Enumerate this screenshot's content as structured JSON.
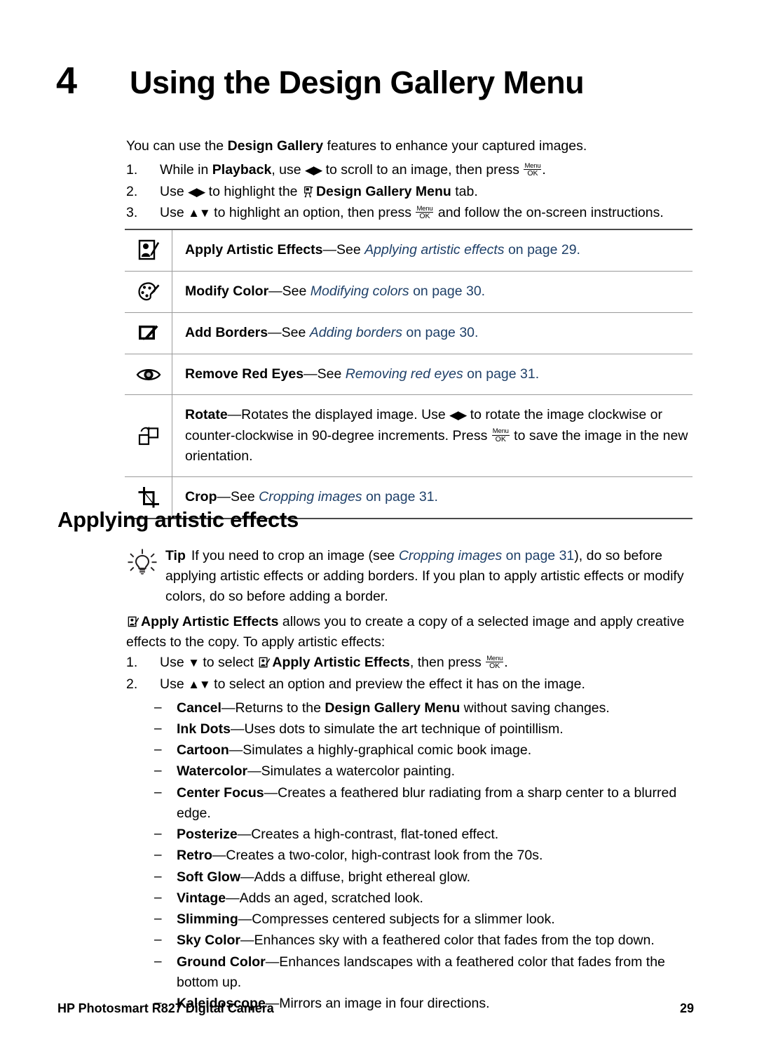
{
  "chapter": {
    "number": "4",
    "title": "Using the Design Gallery Menu"
  },
  "intro": {
    "pre": "You can use the ",
    "bold": "Design Gallery",
    "post": " features to enhance your captured images."
  },
  "steps": [
    {
      "num": "1.",
      "a": "While in ",
      "bold1": "Playback",
      "b": ", use ",
      "arrows": "◀▶",
      "c": " to scroll to an image, then press ",
      "key_top": "Menu",
      "key_bottom": "OK",
      "d": "."
    },
    {
      "num": "2.",
      "a": "Use ",
      "arrows": "◀▶",
      "b": " to highlight the ",
      "icon": "design-gallery-tab-icon",
      "bold1": "Design Gallery Menu",
      "c": " tab."
    },
    {
      "num": "3.",
      "a": "Use ",
      "arrows": "▲▼",
      "b": " to highlight an option, then press ",
      "key_top": "Menu",
      "key_bottom": "OK",
      "c": " and follow the on-screen instructions."
    }
  ],
  "menu_table": {
    "rows": [
      {
        "icon": "artistic-effects-icon",
        "title": "Apply Artistic Effects",
        "dash": "—",
        "see": "See ",
        "link": "Applying artistic effects",
        "tail": " on page 29."
      },
      {
        "icon": "color-palette-icon",
        "title": "Modify Color",
        "dash": "—",
        "see": "See ",
        "link": "Modifying colors",
        "tail": " on page 30."
      },
      {
        "icon": "add-borders-icon",
        "title": "Add Borders",
        "dash": "—",
        "see": "See ",
        "link": "Adding borders",
        "tail": " on page 30."
      },
      {
        "icon": "eye-icon",
        "title": "Remove Red Eyes",
        "dash": "—",
        "see": "See ",
        "link": "Removing red eyes",
        "tail": " on page 31."
      },
      {
        "icon": "rotate-icon",
        "title": "Rotate",
        "dash": "—",
        "body_a": "Rotates the displayed image. Use ",
        "arrows": "◀▶",
        "body_b": " to rotate the image clockwise or counter-clockwise in 90-degree increments. Press ",
        "key_top": "Menu",
        "key_bottom": "OK",
        "body_c": " to save the image in the new orientation."
      },
      {
        "icon": "crop-icon",
        "title": "Crop",
        "dash": "—",
        "see": "See ",
        "link": "Cropping images",
        "tail": " on page 31."
      }
    ]
  },
  "section": {
    "heading": "Applying artistic effects"
  },
  "tip": {
    "icon": "lightbulb-icon",
    "label": "Tip",
    "a": "If you need to crop an image (see ",
    "link": "Cropping images",
    "link_tail": " on page 31",
    "b": "), do so before applying artistic effects or adding borders. If you plan to apply artistic effects or modify colors, do so before adding a border."
  },
  "paragraph": {
    "icon": "artistic-effects-icon",
    "bold": "Apply Artistic Effects",
    "text": " allows you to create a copy of a selected image and apply creative effects to the copy. To apply artistic effects:"
  },
  "procedure": [
    {
      "num": "1.",
      "a": "Use ",
      "arrows": "▼",
      "b": " to select ",
      "icon": "artistic-effects-icon",
      "bold1": "Apply Artistic Effects",
      "c": ", then press ",
      "key_top": "Menu",
      "key_bottom": "OK",
      "d": "."
    },
    {
      "num": "2.",
      "a": "Use ",
      "arrows": "▲▼",
      "b": " to select an option and preview the effect it has on the image."
    }
  ],
  "effects": [
    {
      "mark": "–",
      "name": "Cancel",
      "dash": "—",
      "desc_a": "Returns to the ",
      "bold2": "Design Gallery Menu",
      "desc_b": " without saving changes."
    },
    {
      "mark": "–",
      "name": "Ink Dots",
      "dash": "—",
      "desc_a": "Uses dots to simulate the art technique of pointillism."
    },
    {
      "mark": "–",
      "name": "Cartoon",
      "dash": "—",
      "desc_a": "Simulates a highly-graphical comic book image."
    },
    {
      "mark": "–",
      "name": "Watercolor",
      "dash": "—",
      "desc_a": "Simulates a watercolor painting."
    },
    {
      "mark": "–",
      "name": "Center Focus",
      "dash": "—",
      "desc_a": "Creates a feathered blur radiating from a sharp center to a blurred edge."
    },
    {
      "mark": "–",
      "name": "Posterize",
      "dash": "—",
      "desc_a": "Creates a high-contrast, flat-toned effect."
    },
    {
      "mark": "–",
      "name": "Retro",
      "dash": "—",
      "desc_a": "Creates a two-color, high-contrast look from the 70s."
    },
    {
      "mark": "–",
      "name": "Soft Glow",
      "dash": "—",
      "desc_a": "Adds a diffuse, bright ethereal glow."
    },
    {
      "mark": "–",
      "name": "Vintage",
      "dash": "—",
      "desc_a": "Adds an aged, scratched look."
    },
    {
      "mark": "–",
      "name": "Slimming",
      "dash": "—",
      "desc_a": "Compresses centered subjects for a slimmer look."
    },
    {
      "mark": "–",
      "name": "Sky Color",
      "dash": "—",
      "desc_a": "Enhances sky with a feathered color that fades from the top down."
    },
    {
      "mark": "–",
      "name": "Ground Color",
      "dash": "—",
      "desc_a": "Enhances landscapes with a feathered color that fades from the bottom up."
    },
    {
      "mark": "–",
      "name": "Kaleidoscope",
      "dash": "—",
      "desc_a": "Mirrors an image in four directions."
    }
  ],
  "footer": {
    "left": "HP Photosmart R827 Digital Camera",
    "right": "29"
  },
  "colors": {
    "link": "#1f4068",
    "rule_dark": "#4a4a4a",
    "rule_light": "#9a9a9a",
    "text": "#000000"
  }
}
